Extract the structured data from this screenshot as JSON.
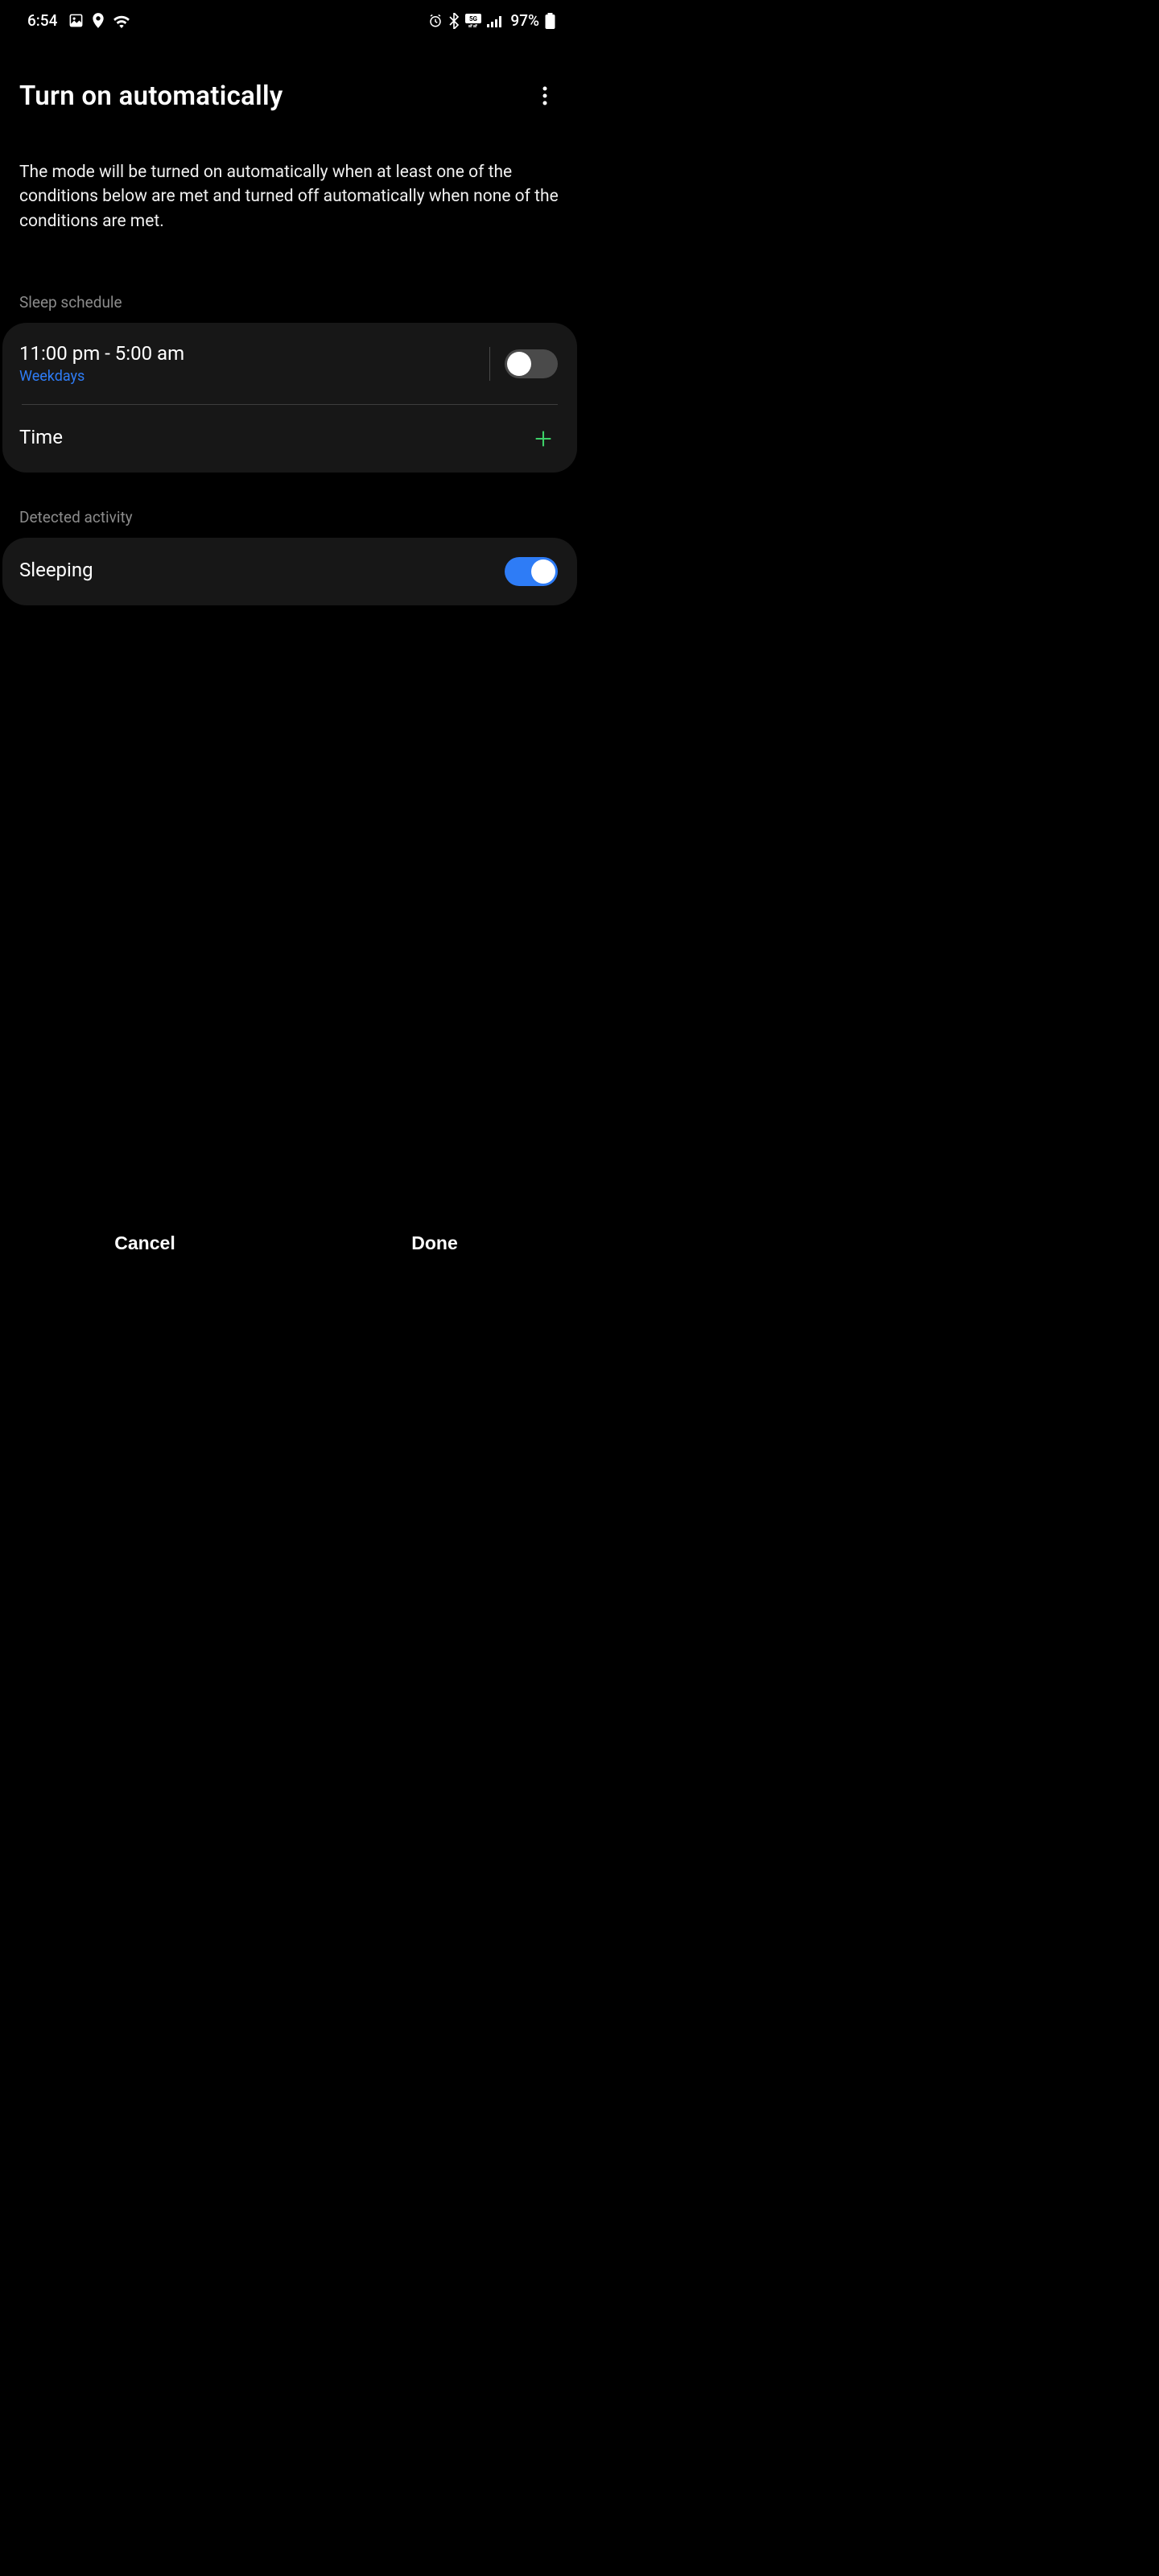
{
  "status_bar": {
    "time": "6:54",
    "battery": "97%"
  },
  "header": {
    "title": "Turn on automatically"
  },
  "description": "The mode will be turned on automatically when at least one of the conditions below are met and turned off automatically when none of the conditions are met.",
  "sections": {
    "sleep_schedule": {
      "label": "Sleep schedule",
      "time_range": "11:00 pm - 5:00 am",
      "days": "Weekdays",
      "enabled": false,
      "add_time_label": "Time"
    },
    "detected_activity": {
      "label": "Detected activity",
      "item": "Sleeping",
      "enabled": true
    }
  },
  "footer": {
    "cancel": "Cancel",
    "done": "Done"
  }
}
